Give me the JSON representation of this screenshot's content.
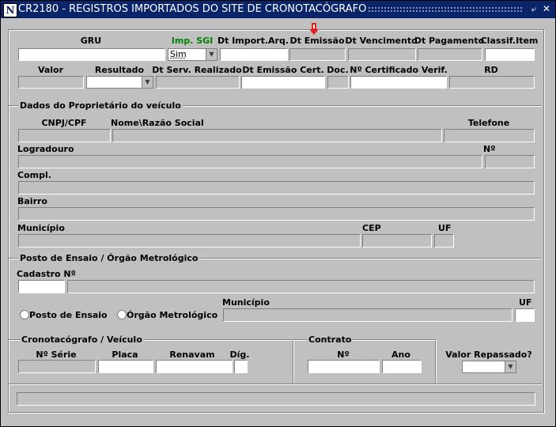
{
  "window": {
    "title": "CR2180 - REGISTROS IMPORTADOS DO SITE DE CRONOTACÓGRAFO",
    "app_icon": "N",
    "title_buttons": [
      "⤶",
      "✕"
    ]
  },
  "row1": {
    "labels": [
      "GRU",
      "Imp. SGI",
      "Dt Import.Arq.",
      "Dt Emissão",
      "Dt Vencimento",
      "Dt Pagamento",
      "Classif.Item"
    ],
    "imp_sgi_value": "Sim"
  },
  "row2": {
    "labels": [
      "Valor",
      "Resultado",
      "Dt Serv. Realizado",
      "Dt Emissão Cert.",
      "Doc.",
      "Nº Certificado Verif.",
      "RD"
    ]
  },
  "proprietario": {
    "section": "Dados do Proprietário do veículo",
    "labels": {
      "cnpj": "CNPJ/CPF",
      "nome": "Nome\\Razão Social",
      "telefone": "Telefone",
      "logradouro": "Logradouro",
      "numero": "Nº",
      "compl": "Compl.",
      "bairro": "Bairro",
      "municipio": "Município",
      "cep": "CEP",
      "uf": "UF"
    }
  },
  "posto": {
    "section": "Posto de Ensaio / Órgão Metrológico",
    "labels": {
      "cadastro": "Cadastro Nº",
      "municipio": "Município",
      "uf": "UF"
    },
    "radios": [
      "Posto de Ensaio",
      "Órgão Metrológico"
    ]
  },
  "crono": {
    "section": "Cronotacógrafo / Veículo",
    "labels": [
      "Nº Série",
      "Placa",
      "Renavam",
      "Díg."
    ]
  },
  "contrato": {
    "section": "Contrato",
    "labels": [
      "Nº",
      "Ano"
    ]
  },
  "repasse": {
    "label": "Valor Repassado?"
  },
  "colors": {
    "title_bg": "#0a246a",
    "window_bg": "#c0c0c0",
    "imp_sgi_label": "#008000",
    "marker": "#e02020"
  }
}
